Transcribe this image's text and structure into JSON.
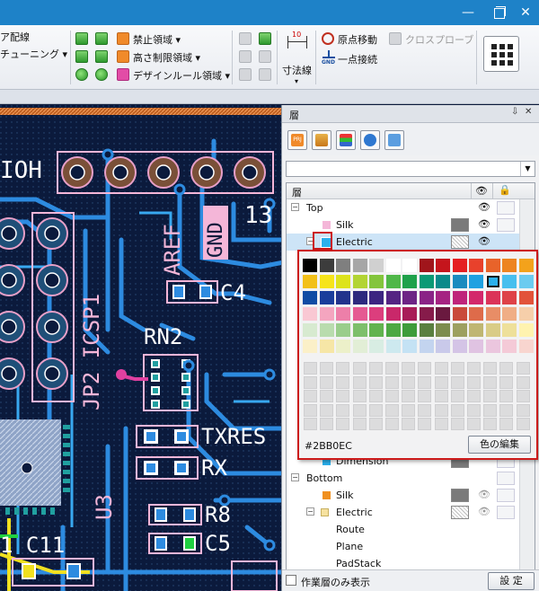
{
  "window": {
    "minimize_glyph": "—",
    "close_glyph": "✕"
  },
  "ribbon": {
    "left_line1": "ア配線",
    "left_line2": "チューニング ▾",
    "region_forbidden": "禁止領域 ▾",
    "region_height": "高さ制限領域 ▾",
    "region_design_rule": "デザインルール領域 ▾",
    "dimension_label": "寸法線",
    "origin_move": "原点移動",
    "cross_probe": "クロスプローブ",
    "gnd_connect": "一点接続",
    "gnd_icon_text": "GND"
  },
  "pcb": {
    "label_ioh": "IOH",
    "label_aref": "AREF",
    "label_gnd": "GND",
    "label_13": "13",
    "label_icsp": "JP2 ICSP1",
    "label_c4": "C4",
    "label_rn2": "RN2",
    "label_txres": "TXRES",
    "label_rx": "RX",
    "label_u3": "U3",
    "label_r8": "R8",
    "label_c5": "C5",
    "label_c11": "1 C11"
  },
  "panel": {
    "title": "層",
    "pin_glyph": "⇩",
    "close_glyph": "✕",
    "tree_header": "層",
    "toolbar_prj": "PRJ",
    "rows": [
      {
        "label": "Top",
        "expander": "−"
      },
      {
        "label": "Silk",
        "color": "#7a7a7a"
      },
      {
        "label": "Electric",
        "expander": "−",
        "color": "#2BB0EC"
      },
      {
        "label": "Dimension",
        "color": "#7a7a7a"
      },
      {
        "label": "Bottom",
        "expander": "−"
      },
      {
        "label": "Silk",
        "color": "#7a7a7a"
      },
      {
        "label": "Electric",
        "expander": "−"
      },
      {
        "label": "Route"
      },
      {
        "label": "Plane"
      },
      {
        "label": "PadStack"
      }
    ],
    "eye_glyph": "👁",
    "lock_glyph": "🔒",
    "work_layer_only": "作業層のみ表示",
    "settings_button": "設 定"
  },
  "picker": {
    "hex_value": "#2BB0EC",
    "edit_button": "色の編集",
    "palette": [
      [
        "#000000",
        "#3c3c3c",
        "#7f7f7f",
        "#a6a6a6",
        "#d0d0d0",
        "#ffffff",
        "#ffffff",
        "#a0151b",
        "#c5151c",
        "#e51f22",
        "#e8412c",
        "#e8632a",
        "#ed8420",
        "#f3a21b"
      ],
      [
        "#f2c018",
        "#f6e41a",
        "#dde31c",
        "#b2d433",
        "#83c53c",
        "#4fb748",
        "#1fa14a",
        "#0a9a75",
        "#0a8a8a",
        "#1a8bbf",
        "#1fa1e1",
        "#2bb0ec",
        "#47bfee",
        "#6bcbf0"
      ],
      [
        "#0f4ca4",
        "#1a3d9b",
        "#22338c",
        "#2d2a7e",
        "#3c2581",
        "#542483",
        "#6d2485",
        "#8a2486",
        "#a52482",
        "#bf247a",
        "#d3286b",
        "#db3359",
        "#de4248",
        "#e2533a"
      ],
      [
        "#f9c8d3",
        "#f4a5bf",
        "#ed7fa9",
        "#e55a92",
        "#dc3e7d",
        "#c9286a",
        "#a81d58",
        "#861b4a",
        "#6a193f",
        "#c94a3a",
        "#de6b4a",
        "#e88d66",
        "#f0ae86",
        "#f6cfaa"
      ],
      [
        "#d7ead0",
        "#b9dcae",
        "#9acd8b",
        "#7dbf6b",
        "#62b34f",
        "#4da843",
        "#3e9c3b",
        "#5a7f3f",
        "#7c8c4e",
        "#9da060",
        "#bfb672",
        "#d9cc86",
        "#eee09a",
        "#fff3b0"
      ],
      [
        "#fbf0c8",
        "#f6e6a6",
        "#ecf0c9",
        "#e2eed6",
        "#d8ede3",
        "#cde9ef",
        "#c4e2f4",
        "#c3d4ef",
        "#c9c9ea",
        "#d4c4e6",
        "#e0c3e2",
        "#ebc6de",
        "#f4cad7",
        "#f8d5cf"
      ]
    ]
  }
}
